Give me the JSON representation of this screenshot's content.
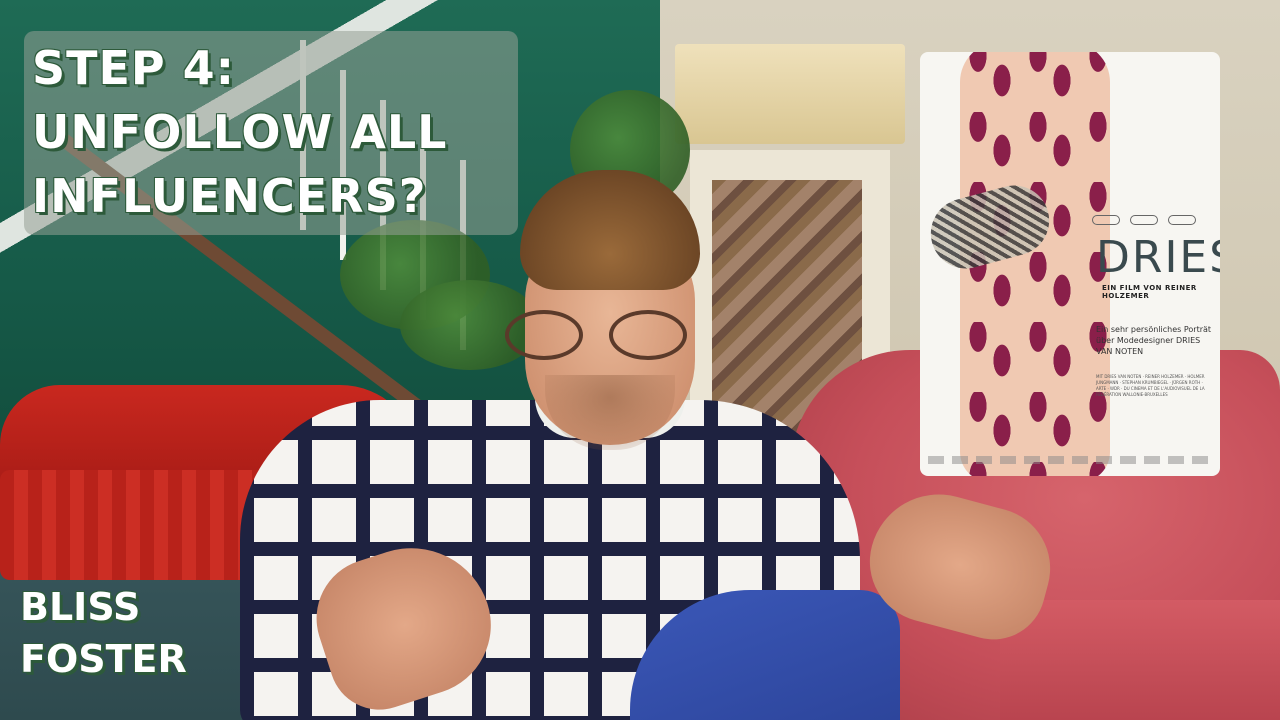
{
  "title_card": {
    "lines": [
      "STEP 4:",
      "UNFOLLOW ALL",
      "INFLUENCERS?"
    ]
  },
  "channel_name": {
    "lines": [
      "BLISS",
      "FOSTER"
    ]
  },
  "poster": {
    "title": "DRIES",
    "subtitle": "EIN FILM VON REINER HOLZEMER",
    "description": "Ein sehr persönliches Porträt über Modedesigner DRIES VAN NOTEN",
    "credits": "MIT DRIES VAN NOTEN · REINER HOLZEMER · HOLMER JUNGMANN · STEPHAN KRUMBIEGEL · JÜRGEN ROTH · ARTE · WDR · DU CINEMA ET DE L'AUDIOVISUEL DE LA FÉDÉRATION WALLONIE-BRUXELLES"
  }
}
